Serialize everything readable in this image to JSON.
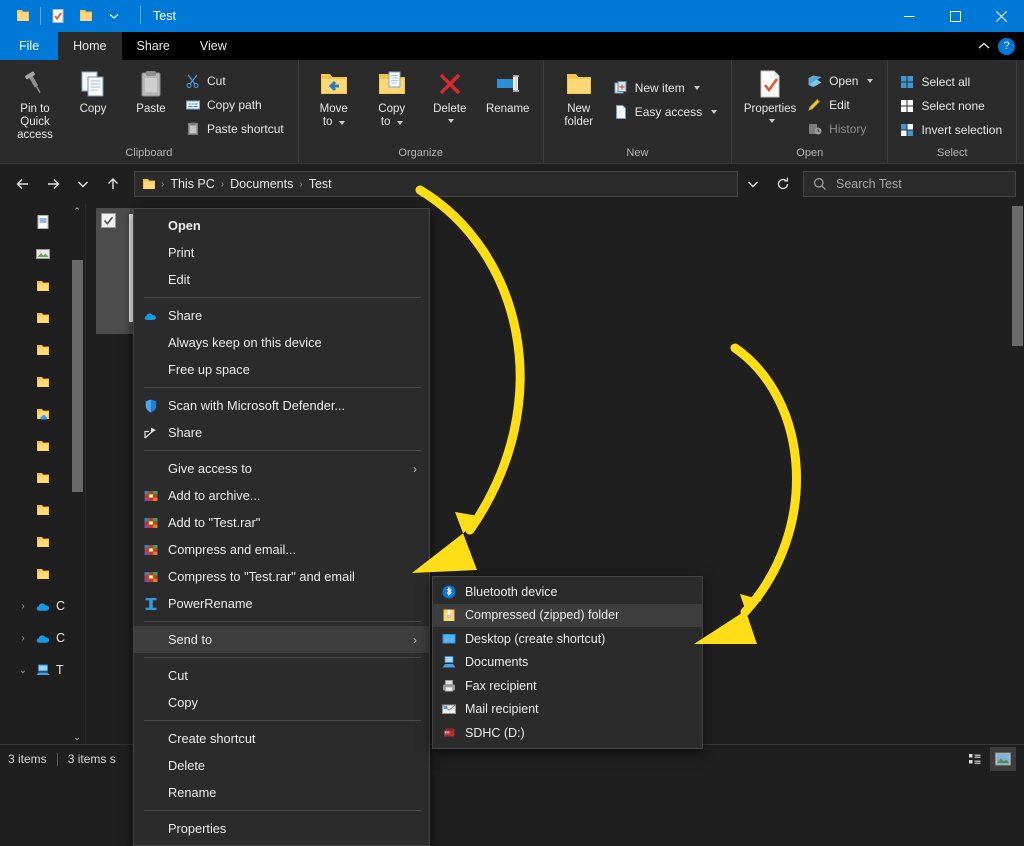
{
  "window": {
    "title": "Test",
    "quick_access": [
      "folder-icon",
      "properties-check-icon",
      "new-folder-icon"
    ],
    "qat_dropdown": "chevron-down-icon",
    "controls": {
      "minimize": "minimize-icon",
      "maximize": "maximize-icon",
      "close": "close-icon"
    },
    "accent_color": "#0078d7",
    "background_color": "#1f1f1f"
  },
  "ribbon": {
    "tabs": [
      {
        "label": "File",
        "state": "file"
      },
      {
        "label": "Home",
        "state": "active"
      },
      {
        "label": "Share",
        "state": "normal"
      },
      {
        "label": "View",
        "state": "normal"
      }
    ],
    "collapse_icon": "chevron-up-icon",
    "help_label": "?",
    "groups": [
      {
        "name": "Clipboard",
        "big_buttons": [
          {
            "label": "Pin to Quick\naccess",
            "icon": "pin-icon"
          },
          {
            "label": "Copy",
            "icon": "copy-icon"
          },
          {
            "label": "Paste",
            "icon": "paste-icon"
          }
        ],
        "small_buttons": [
          {
            "label": "Cut",
            "icon": "scissors-icon"
          },
          {
            "label": "Copy path",
            "icon": "copy-path-icon"
          },
          {
            "label": "Paste shortcut",
            "icon": "paste-shortcut-icon"
          }
        ]
      },
      {
        "name": "Organize",
        "big_buttons": [
          {
            "label": "Move\nto",
            "icon": "move-to-icon",
            "dropdown": true
          },
          {
            "label": "Copy\nto",
            "icon": "copy-to-icon",
            "dropdown": true
          },
          {
            "label": "Delete",
            "icon": "delete-x-icon",
            "dropdown": true
          },
          {
            "label": "Rename",
            "icon": "rename-icon"
          }
        ],
        "small_buttons": []
      },
      {
        "name": "New",
        "big_buttons": [
          {
            "label": "New\nfolder",
            "icon": "new-folder-icon"
          }
        ],
        "small_buttons": [
          {
            "label": "New item",
            "icon": "new-item-icon",
            "dropdown": true
          },
          {
            "label": "Easy access",
            "icon": "easy-access-icon",
            "dropdown": true
          }
        ]
      },
      {
        "name": "Open",
        "big_buttons": [
          {
            "label": "Properties",
            "icon": "properties-icon",
            "dropdown": true
          }
        ],
        "small_buttons": [
          {
            "label": "Open",
            "icon": "open-icon",
            "dropdown": true
          },
          {
            "label": "Edit",
            "icon": "edit-pencil-icon"
          },
          {
            "label": "History",
            "icon": "history-icon"
          }
        ]
      },
      {
        "name": "Select",
        "big_buttons": [],
        "small_buttons": [
          {
            "label": "Select all",
            "icon": "select-all-icon"
          },
          {
            "label": "Select none",
            "icon": "select-none-icon"
          },
          {
            "label": "Invert selection",
            "icon": "invert-selection-icon"
          }
        ]
      }
    ]
  },
  "address_bar": {
    "back": "back-arrow-icon",
    "forward": "forward-arrow-icon",
    "recent": "chevron-down-icon",
    "up": "up-arrow-icon",
    "breadcrumb_icon": "folder-icon",
    "breadcrumbs": [
      "This PC",
      "Documents",
      "Test"
    ],
    "separator": "›",
    "history_dropdown": "chevron-down-icon",
    "refresh": "refresh-icon",
    "search_placeholder": "Search Test",
    "search_icon": "search-icon"
  },
  "nav_pane": {
    "items": [
      {
        "icon": "document-icon",
        "label": "",
        "chevron": ""
      },
      {
        "icon": "picture-icon",
        "label": "",
        "chevron": ""
      },
      {
        "icon": "folder-icon",
        "label": "",
        "chevron": ""
      },
      {
        "icon": "folder-icon",
        "label": "",
        "chevron": ""
      },
      {
        "icon": "folder-icon",
        "label": "",
        "chevron": ""
      },
      {
        "icon": "folder-icon",
        "label": "",
        "chevron": ""
      },
      {
        "icon": "folder-cloud-icon",
        "label": "",
        "chevron": ""
      },
      {
        "icon": "folder-icon",
        "label": "",
        "chevron": ""
      },
      {
        "icon": "folder-icon",
        "label": "",
        "chevron": ""
      },
      {
        "icon": "folder-icon",
        "label": "",
        "chevron": ""
      },
      {
        "icon": "folder-icon",
        "label": "",
        "chevron": ""
      },
      {
        "icon": "folder-icon",
        "label": "",
        "chevron": ""
      },
      {
        "icon": "onedrive-icon",
        "label": "C",
        "chevron": "›"
      },
      {
        "icon": "onedrive-icon",
        "label": "C",
        "chevron": "›"
      },
      {
        "icon": "this-pc-icon",
        "label": "T",
        "chevron": "⌄"
      }
    ],
    "scroll_up": "⌃",
    "scroll_down": "⌄"
  },
  "file_pane": {
    "selected_item": {
      "checked": true,
      "icon": "document-thumbnail"
    }
  },
  "context_menu": {
    "items": [
      {
        "label": "Open",
        "icon": "",
        "bold": true,
        "type": "item"
      },
      {
        "label": "Print",
        "icon": "",
        "type": "item"
      },
      {
        "label": "Edit",
        "icon": "",
        "type": "item"
      },
      {
        "type": "separator"
      },
      {
        "label": "Share",
        "icon": "onedrive-cloud-icon",
        "type": "item"
      },
      {
        "label": "Always keep on this device",
        "icon": "",
        "type": "item"
      },
      {
        "label": "Free up space",
        "icon": "",
        "type": "item"
      },
      {
        "type": "separator"
      },
      {
        "label": "Scan with Microsoft Defender...",
        "icon": "shield-icon",
        "type": "item"
      },
      {
        "label": "Share",
        "icon": "share-arrow-icon",
        "type": "item"
      },
      {
        "type": "separator"
      },
      {
        "label": "Give access to",
        "icon": "",
        "type": "item",
        "submenu": true
      },
      {
        "label": "Add to archive...",
        "icon": "winrar-icon",
        "type": "item"
      },
      {
        "label": "Add to \"Test.rar\"",
        "icon": "winrar-icon",
        "type": "item"
      },
      {
        "label": "Compress and email...",
        "icon": "winrar-icon",
        "type": "item"
      },
      {
        "label": "Compress to \"Test.rar\" and email",
        "icon": "winrar-icon",
        "type": "item"
      },
      {
        "label": "PowerRename",
        "icon": "powerrename-icon",
        "type": "item"
      },
      {
        "type": "separator"
      },
      {
        "label": "Send to",
        "icon": "",
        "type": "item",
        "submenu": true,
        "highlighted": true
      },
      {
        "type": "separator"
      },
      {
        "label": "Cut",
        "icon": "",
        "type": "item"
      },
      {
        "label": "Copy",
        "icon": "",
        "type": "item"
      },
      {
        "type": "separator"
      },
      {
        "label": "Create shortcut",
        "icon": "",
        "type": "item"
      },
      {
        "label": "Delete",
        "icon": "",
        "type": "item"
      },
      {
        "label": "Rename",
        "icon": "",
        "type": "item"
      },
      {
        "type": "separator"
      },
      {
        "label": "Properties",
        "icon": "",
        "type": "item"
      }
    ]
  },
  "send_to_submenu": {
    "items": [
      {
        "label": "Bluetooth device",
        "icon": "bluetooth-icon"
      },
      {
        "label": "Compressed (zipped) folder",
        "icon": "zip-folder-icon",
        "highlighted": true
      },
      {
        "label": "Desktop (create shortcut)",
        "icon": "desktop-icon"
      },
      {
        "label": "Documents",
        "icon": "documents-icon"
      },
      {
        "label": "Fax recipient",
        "icon": "fax-icon"
      },
      {
        "label": "Mail recipient",
        "icon": "mail-icon"
      },
      {
        "label": "SDHC (D:)",
        "icon": "sdhc-drive-icon"
      }
    ]
  },
  "status_bar": {
    "item_count": "3 items",
    "selected_info": "3 items s",
    "view_details_icon": "details-view-icon",
    "view_thumbnails_icon": "thumbnails-view-icon"
  },
  "annotations": {
    "color": "#FFDE17",
    "arrow_1": "curved-arrow-to-send-to",
    "arrow_2": "curved-arrow-to-compressed-zipped-folder"
  }
}
